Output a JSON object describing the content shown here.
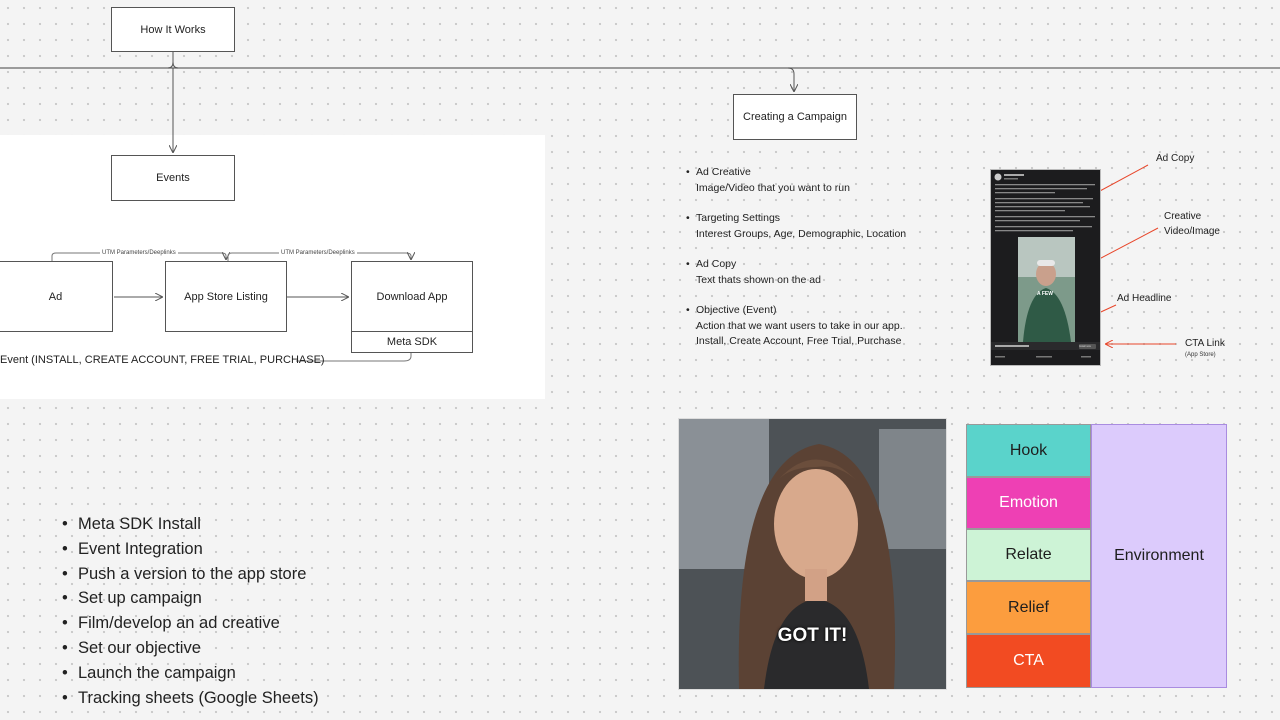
{
  "flow": {
    "how_it_works": "How It Works",
    "events": "Events",
    "ad": "Ad",
    "app_store_listing": "App Store Listing",
    "download_app": "Download App",
    "meta_sdk": "Meta SDK",
    "utm_1": "UTM Parameters/Deeplinks",
    "utm_2": "UTM Parameters/Deeplinks",
    "event_line": "Event (INSTALL, CREATE ACCOUNT, FREE TRIAL, PURCHASE)"
  },
  "campaign": {
    "title": "Creating a Campaign",
    "items": [
      {
        "title": "Ad Creative",
        "desc": "Image/Video that you want to run"
      },
      {
        "title": "Targeting Settings",
        "desc": "Interest Groups, Age, Demographic, Location"
      },
      {
        "title": "Ad Copy",
        "desc": "Text thats shown on the ad"
      },
      {
        "title": "Objective (Event)",
        "desc": "Action that we want users to take in our app.",
        "desc2": "Install, Create Account, Free Trial, Purchase"
      }
    ]
  },
  "annotations": {
    "ad_copy": "Ad Copy",
    "creative_line1": "Creative",
    "creative_line2": "Video/Image",
    "ad_headline": "Ad Headline",
    "cta_link": "CTA Link",
    "cta_sub": "(App Store)"
  },
  "phone_mock": {
    "video_overlay": "A FEW",
    "cta_button": "Install now"
  },
  "steps": [
    "Meta SDK Install",
    "Event Integration",
    "Push a version to the app store",
    "Set up campaign",
    "Film/develop an ad creative",
    "Set our objective",
    "Launch the campaign",
    "Tracking sheets (Google Sheets)"
  ],
  "video_caption": "GOT IT!",
  "framework": {
    "hook": "Hook",
    "emotion": "Emotion",
    "relate": "Relate",
    "relief": "Relief",
    "cta": "CTA",
    "environment": "Environment"
  },
  "colors": {
    "hook": "#5ad3cb",
    "emotion": "#ee40b4",
    "relate": "#cdf3d6",
    "relief": "#fc9d3e",
    "cta": "#f24b22",
    "environment": "#dccbfc",
    "arrow_red": "#e8462a"
  }
}
